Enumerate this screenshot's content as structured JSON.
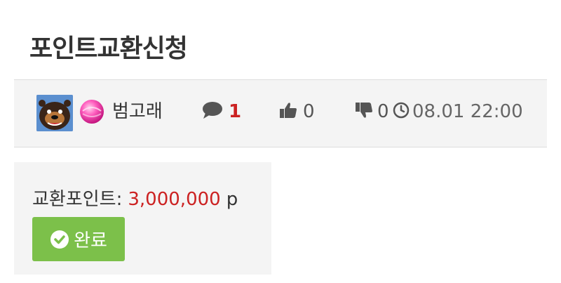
{
  "page": {
    "title": "포인트교환신청"
  },
  "meta": {
    "author_name": "범고래",
    "comment_count": "1",
    "like_count": "0",
    "dislike_count": "0",
    "date": "08.01 22:00"
  },
  "panel": {
    "points_label": "교환포인트:",
    "points_value": "3,000,000",
    "points_unit": "p",
    "status_label": "완료"
  },
  "colors": {
    "accent_red": "#cc2222",
    "button_green": "#7cc04a",
    "panel_bg": "#f4f4f4"
  },
  "icons": {
    "avatar": "avatar-image",
    "level": "pink-orb-icon",
    "comment": "comment-icon",
    "like": "thumbs-up-icon",
    "dislike": "thumbs-down-icon",
    "clock": "clock-icon",
    "check": "check-circle-icon"
  }
}
